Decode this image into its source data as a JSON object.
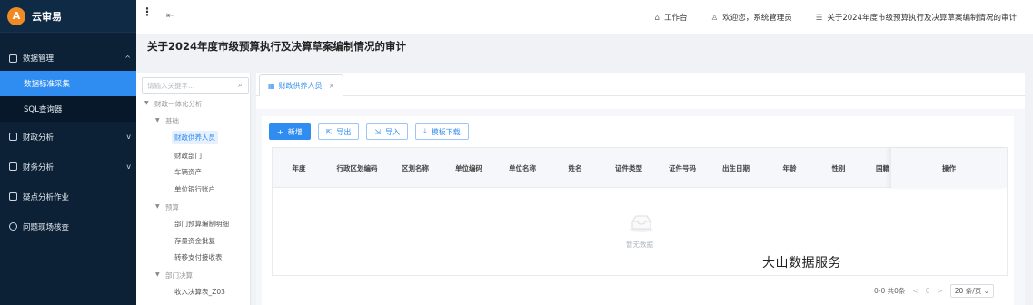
{
  "brand": {
    "name": "云审易",
    "logo_text": "A"
  },
  "sidebar": {
    "items": [
      {
        "label": "数据管理",
        "icon": "doc-icon",
        "arrow": "^"
      },
      {
        "label": "数据标准采集",
        "sub": true,
        "active": true
      },
      {
        "label": "SQL查询器",
        "sub": true
      },
      {
        "label": "财政分析",
        "icon": "card-icon",
        "arrow": "v"
      },
      {
        "label": "财务分析",
        "icon": "ledger-icon",
        "arrow": "v"
      },
      {
        "label": "疑点分析作业",
        "icon": "monitor-icon"
      },
      {
        "label": "问题现场核查",
        "icon": "question-icon"
      }
    ]
  },
  "topbar": {
    "menu_glyph": "⋮",
    "collapse_glyph": "⇤",
    "workbench": "工作台",
    "welcome": "欢迎您，系统管理员",
    "project": "关于2024年度市级预算执行及决算草案编制情况的审计"
  },
  "page": {
    "title": "关于2024年度市级预算执行及决算草案编制情况的审计"
  },
  "tree": {
    "search_placeholder": "请输入关键字...",
    "nodes": [
      {
        "label": "财政一体化分析",
        "level": 0
      },
      {
        "label": "基础",
        "level": 1
      },
      {
        "label": "财政供养人员",
        "level": 2,
        "selected": true
      },
      {
        "label": "财政部门",
        "level": 2
      },
      {
        "label": "车辆资产",
        "level": 2
      },
      {
        "label": "单位银行账户",
        "level": 2
      },
      {
        "label": "预算",
        "level": 1
      },
      {
        "label": "部门预算编制明细",
        "level": 2
      },
      {
        "label": "存量资金批复",
        "level": 2
      },
      {
        "label": "转移支付接收表",
        "level": 2
      },
      {
        "label": "部门决算",
        "level": 1
      },
      {
        "label": "收入决算表_Z03",
        "level": 2
      }
    ]
  },
  "tab": {
    "label": "财政供养人员",
    "close": "×"
  },
  "buttons": {
    "add": "新增",
    "export": "导出",
    "import": "导入",
    "template": "模板下载"
  },
  "table": {
    "columns": [
      "年度",
      "行政区划编码",
      "区划名称",
      "单位编码",
      "单位名称",
      "姓名",
      "证件类型",
      "证件号码",
      "出生日期",
      "年龄",
      "性别",
      "国籍"
    ],
    "operation": "操作",
    "empty_text": "暂无数据"
  },
  "watermark": "大山数据服务",
  "pager": {
    "summary": "0-0 共0条",
    "prev": "<",
    "page": "0",
    "next": ">",
    "page_size": "20 条/页"
  },
  "colors": {
    "primary": "#2f8cf0",
    "sidebar_bg": "#0c2135",
    "brand_orange": "#f08a24"
  }
}
